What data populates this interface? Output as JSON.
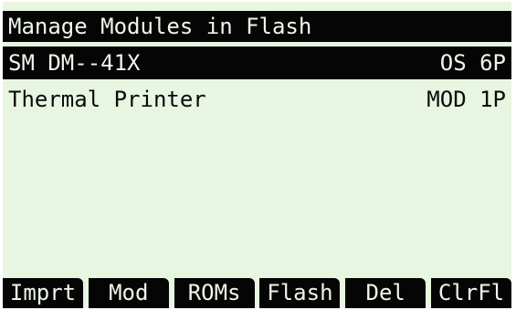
{
  "title": "Manage Modules in Flash",
  "modules": [
    {
      "name": "SM DM--41X",
      "type": "OS 6P",
      "selected": true
    },
    {
      "name": "Thermal Printer",
      "type": "MOD 1P",
      "selected": false
    }
  ],
  "softkeys": [
    "Imprt",
    "Mod",
    "ROMs",
    "Flash",
    "Del",
    "ClrFl"
  ],
  "colors": {
    "screen_bg": "#e8f5e0",
    "ink": "#050505"
  }
}
